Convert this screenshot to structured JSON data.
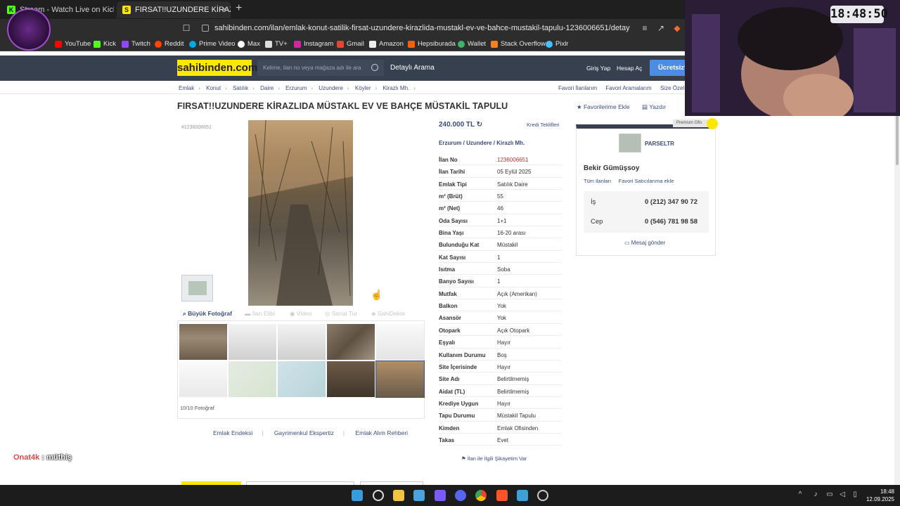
{
  "browser": {
    "tabs": [
      {
        "label": "Stream - Watch Live on Kick"
      },
      {
        "label": "FIRSAT!!UZUNDERE KİRAZLIDA M..."
      }
    ],
    "new_tab": "+",
    "close": "×",
    "url": "sahibinden.com/ilan/emlak-konut-satilik-firsat-uzundere-kirazlida-mustakl-ev-ve-bahce-mustakil-tapulu-1236006651/detay",
    "bookmarks": [
      "YouTube",
      "Kick",
      "Twitch",
      "Reddit",
      "Prime Video",
      "Max",
      "TV+",
      "Instagram",
      "Gmail",
      "Amazon",
      "Hepsiburada",
      "Wallet",
      "Stack Overflow",
      "Pixlr"
    ]
  },
  "header": {
    "logo": "sahibinden.com",
    "search_placeholder": "Kelime, ilan no veya mağaza adı ile ara",
    "detailed_search": "Detaylı Arama",
    "login": "Giriş Yap",
    "register": "Hesap Aç",
    "free_button": "Ücretsiz*"
  },
  "breadcrumb": [
    "Emlak",
    "Konut",
    "Satılık",
    "Daire",
    "Erzurum",
    "Uzundere",
    "Köyler",
    "Kirazlı Mh."
  ],
  "breadcrumb_right": [
    "Favori İlanlarım",
    "Favori Aramalarım",
    "Size Özel İlanla"
  ],
  "listing": {
    "title": "FIRSAT!!UZUNDERE KİRAZLIDA MÜSTAKL EV VE BAHÇE MÜSTAKİL TAPULU",
    "add_favorite": "Favorilerime Ekle",
    "print": "Yazdır",
    "id_small": "#1236006651",
    "price": "240.000 TL",
    "credit_offers": "Kredi Teklifleri",
    "location": [
      "Erzurum",
      "Uzundere",
      "Kirazlı Mh."
    ],
    "photo_tools": {
      "big_photo": "Büyük Fotoğraf",
      "map": "İlan Elibi",
      "video": "Video",
      "virtual": "Sanal Tur",
      "safe": "SahiDekor"
    },
    "photo_count": "10/10 Fotoğraf",
    "details": [
      {
        "key": "İlan No",
        "value": "1236006651"
      },
      {
        "key": "İlan Tarihi",
        "value": "05 Eylül 2025"
      },
      {
        "key": "Emlak Tipi",
        "value": "Satılık Daire"
      },
      {
        "key": "m² (Brüt)",
        "value": "55"
      },
      {
        "key": "m² (Net)",
        "value": "46"
      },
      {
        "key": "Oda Sayısı",
        "value": "1+1"
      },
      {
        "key": "Bina Yaşı",
        "value": "16-20 arası"
      },
      {
        "key": "Bulunduğu Kat",
        "value": "Müstakil"
      },
      {
        "key": "Kat Sayısı",
        "value": "1"
      },
      {
        "key": "Isıtma",
        "value": "Soba"
      },
      {
        "key": "Banyo Sayısı",
        "value": "1"
      },
      {
        "key": "Mutfak",
        "value": "Açık (Amerikan)"
      },
      {
        "key": "Balkon",
        "value": "Yok"
      },
      {
        "key": "Asansör",
        "value": "Yok"
      },
      {
        "key": "Otopark",
        "value": "Açık Otopark"
      },
      {
        "key": "Eşyalı",
        "value": "Hayır"
      },
      {
        "key": "Kullanım Durumu",
        "value": "Boş"
      },
      {
        "key": "Site İçerisinde",
        "value": "Hayır"
      },
      {
        "key": "Site Adı",
        "value": "Belirtilmemiş"
      },
      {
        "key": "Aidat (TL)",
        "value": "Belirtilmemiş"
      },
      {
        "key": "Krediye Uygun",
        "value": "Hayır"
      },
      {
        "key": "Tapu Durumu",
        "value": "Müstakil Tapulu"
      },
      {
        "key": "Kimden",
        "value": "Emlak Ofisinden"
      },
      {
        "key": "Takas",
        "value": "Evet"
      }
    ],
    "complaint": "İlan ile İlgili Şikayetim Var"
  },
  "seller": {
    "premium": "Premium Ofis",
    "store": "PARSELTR",
    "name": "Bekir Gümüşsoy",
    "all_listings": "Tüm ilanları",
    "add_favorite_seller": "Favori Satıcılarıma ekle",
    "phones": [
      {
        "label": "İş",
        "number": "0 (212) 347 90 72"
      },
      {
        "label": "Cep",
        "number": "0 (546) 781 98 58"
      }
    ],
    "message": "Mesaj gönder"
  },
  "footer_links": [
    "Emlak Endeksi",
    "Gayrimenkul Ekspertiz",
    "Emlak Alım Rehberi"
  ],
  "overlay": {
    "clock": "18:48:50",
    "chat_user": "Onat4k",
    "chat_sep": " : ",
    "chat_text": "müthiş"
  },
  "taskbar": {
    "time": "18:48",
    "date": "12.09.2025"
  }
}
